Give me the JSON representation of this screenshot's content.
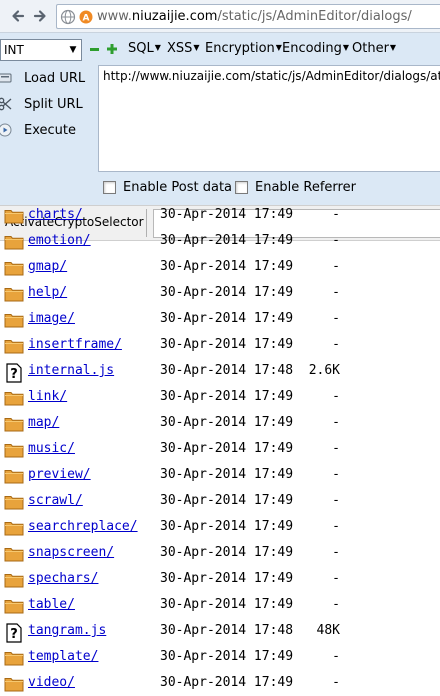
{
  "address": {
    "url_prefix": "www.",
    "url_domain": "niuzaijie.com",
    "url_path": "/static/js/AdminEditor/dialogs/"
  },
  "hackbar": {
    "select_value": "INT",
    "menus": [
      "SQL",
      "XSS",
      "Encryption",
      "Encoding",
      "Other"
    ],
    "load_url": "Load URL",
    "split_url": "Split URL",
    "execute": "Execute",
    "url_value": "http://www.niuzaijie.com/static/js/AdminEditor/dialogs/atta",
    "enable_post": "Enable Post data",
    "enable_referrer": "Enable Referrer",
    "crypto_label": "ActivateCryptoSelector"
  },
  "listing": [
    {
      "name": "charts/",
      "date": "30-Apr-2014 17:49",
      "size": "-",
      "type": "folder"
    },
    {
      "name": "emotion/",
      "date": "30-Apr-2014 17:49",
      "size": "-",
      "type": "folder"
    },
    {
      "name": "gmap/",
      "date": "30-Apr-2014 17:49",
      "size": "-",
      "type": "folder"
    },
    {
      "name": "help/",
      "date": "30-Apr-2014 17:49",
      "size": "-",
      "type": "folder"
    },
    {
      "name": "image/",
      "date": "30-Apr-2014 17:49",
      "size": "-",
      "type": "folder"
    },
    {
      "name": "insertframe/",
      "date": "30-Apr-2014 17:49",
      "size": "-",
      "type": "folder"
    },
    {
      "name": "internal.js",
      "date": "30-Apr-2014 17:48",
      "size": "2.6K",
      "type": "file"
    },
    {
      "name": "link/",
      "date": "30-Apr-2014 17:49",
      "size": "-",
      "type": "folder"
    },
    {
      "name": "map/",
      "date": "30-Apr-2014 17:49",
      "size": "-",
      "type": "folder"
    },
    {
      "name": "music/",
      "date": "30-Apr-2014 17:49",
      "size": "-",
      "type": "folder"
    },
    {
      "name": "preview/",
      "date": "30-Apr-2014 17:49",
      "size": "-",
      "type": "folder"
    },
    {
      "name": "scrawl/",
      "date": "30-Apr-2014 17:49",
      "size": "-",
      "type": "folder"
    },
    {
      "name": "searchreplace/",
      "date": "30-Apr-2014 17:49",
      "size": "-",
      "type": "folder"
    },
    {
      "name": "snapscreen/",
      "date": "30-Apr-2014 17:49",
      "size": "-",
      "type": "folder"
    },
    {
      "name": "spechars/",
      "date": "30-Apr-2014 17:49",
      "size": "-",
      "type": "folder"
    },
    {
      "name": "table/",
      "date": "30-Apr-2014 17:49",
      "size": "-",
      "type": "folder"
    },
    {
      "name": "tangram.js",
      "date": "30-Apr-2014 17:48",
      "size": "48K",
      "type": "file"
    },
    {
      "name": "template/",
      "date": "30-Apr-2014 17:49",
      "size": "-",
      "type": "folder"
    },
    {
      "name": "video/",
      "date": "30-Apr-2014 17:49",
      "size": "-",
      "type": "folder"
    }
  ],
  "colors": {
    "link": "#0000cc",
    "folder": "#e8a33c",
    "hackbar_bg": "#dbe8f5"
  }
}
